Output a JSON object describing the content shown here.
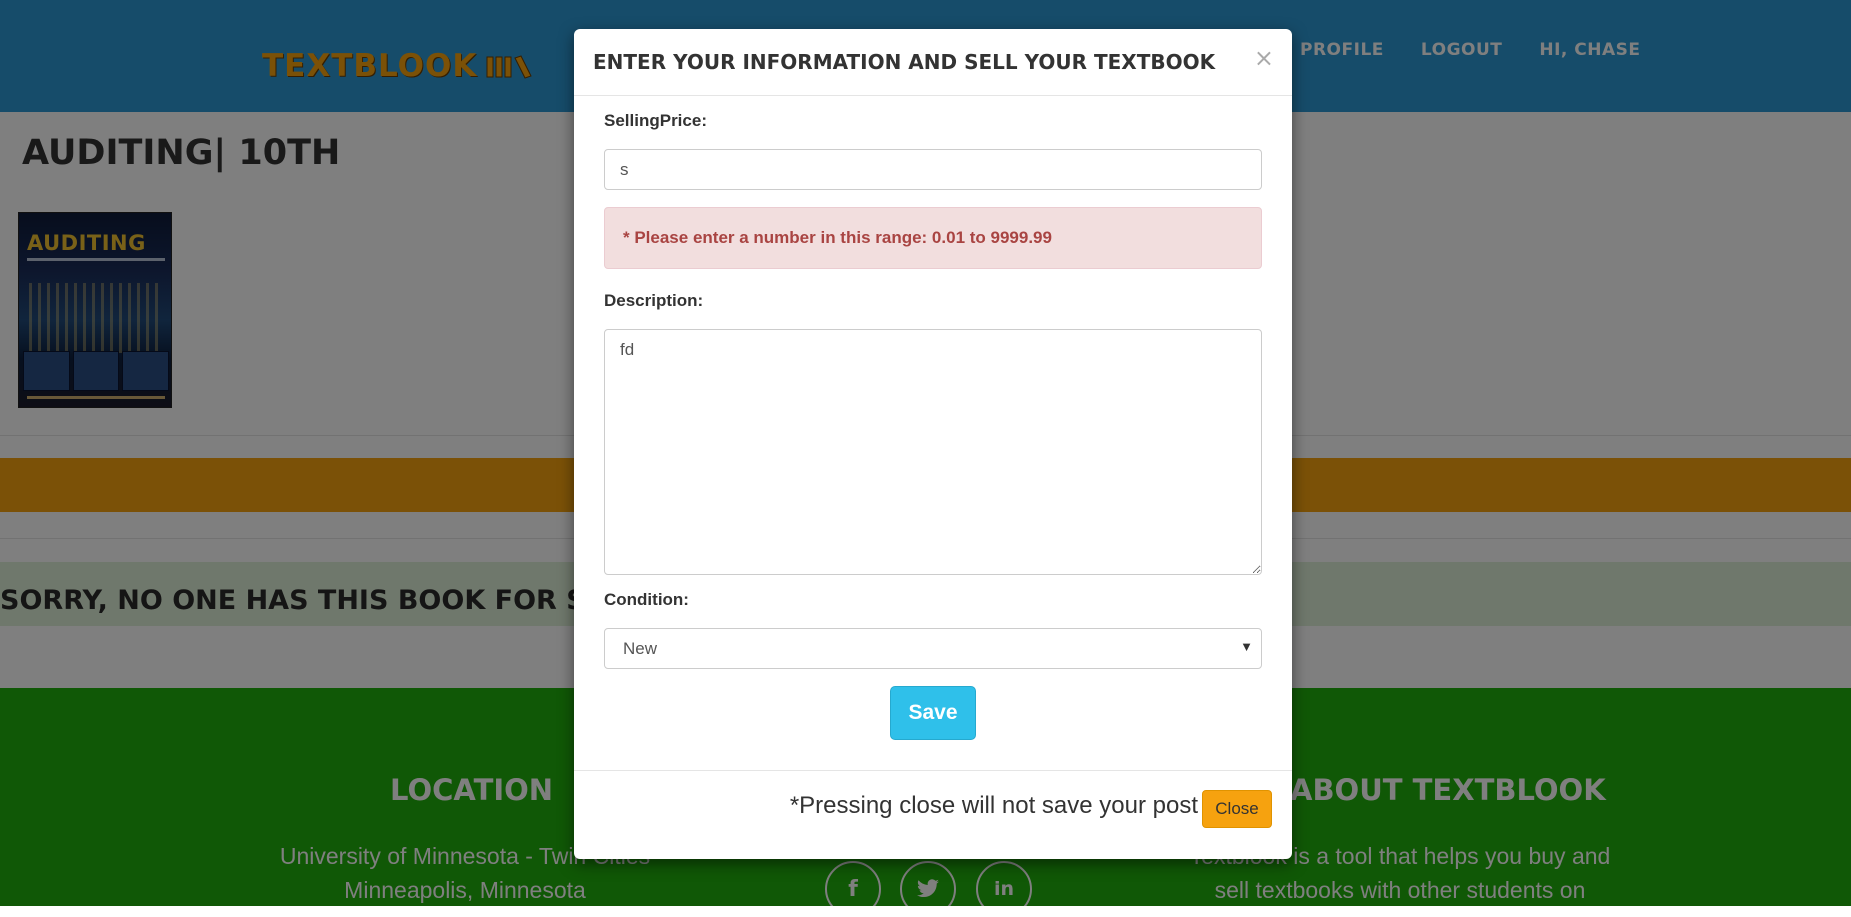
{
  "navbar": {
    "brand": "TEXTBLOOK",
    "links": [
      "PROFILE",
      "LOGOUT",
      "HI, CHASE"
    ]
  },
  "book": {
    "title": "AUDITING| 10TH",
    "cover_title": "AUDITING"
  },
  "listing": {
    "empty_message": "SORRY, NO ONE HAS THIS BOOK FOR SALE"
  },
  "footer": {
    "location_heading": "LOCATION",
    "location_lines": [
      "University of Minnesota - Twin Cities",
      "Minneapolis, Minnesota"
    ],
    "about_heading": "ABOUT TEXTBLOOK",
    "about_lines": [
      "Textblook is a tool that helps you buy and",
      "sell textbooks with other students on"
    ],
    "social_icons": [
      "facebook-icon",
      "twitter-icon",
      "linkedin-icon"
    ]
  },
  "modal": {
    "title": "ENTER YOUR INFORMATION AND SELL YOUR TEXTBOOK",
    "close_symbol": "×",
    "price_label": "SellingPrice:",
    "price_value": "s",
    "price_error": "* Please enter a number in this range: 0.01 to 9999.99",
    "description_label": "Description:",
    "description_value": "fd",
    "condition_label": "Condition:",
    "condition_value": "New",
    "save_label": "Save",
    "footer_note": "*Pressing close will not save your post",
    "close_label": "Close"
  },
  "colors": {
    "navbar": "#2c99d4",
    "brand": "#f6a20f",
    "footer": "#21b00d",
    "save_button": "#2fc0ea",
    "close_button": "#f6a20f",
    "error_bg": "#f2dede"
  }
}
